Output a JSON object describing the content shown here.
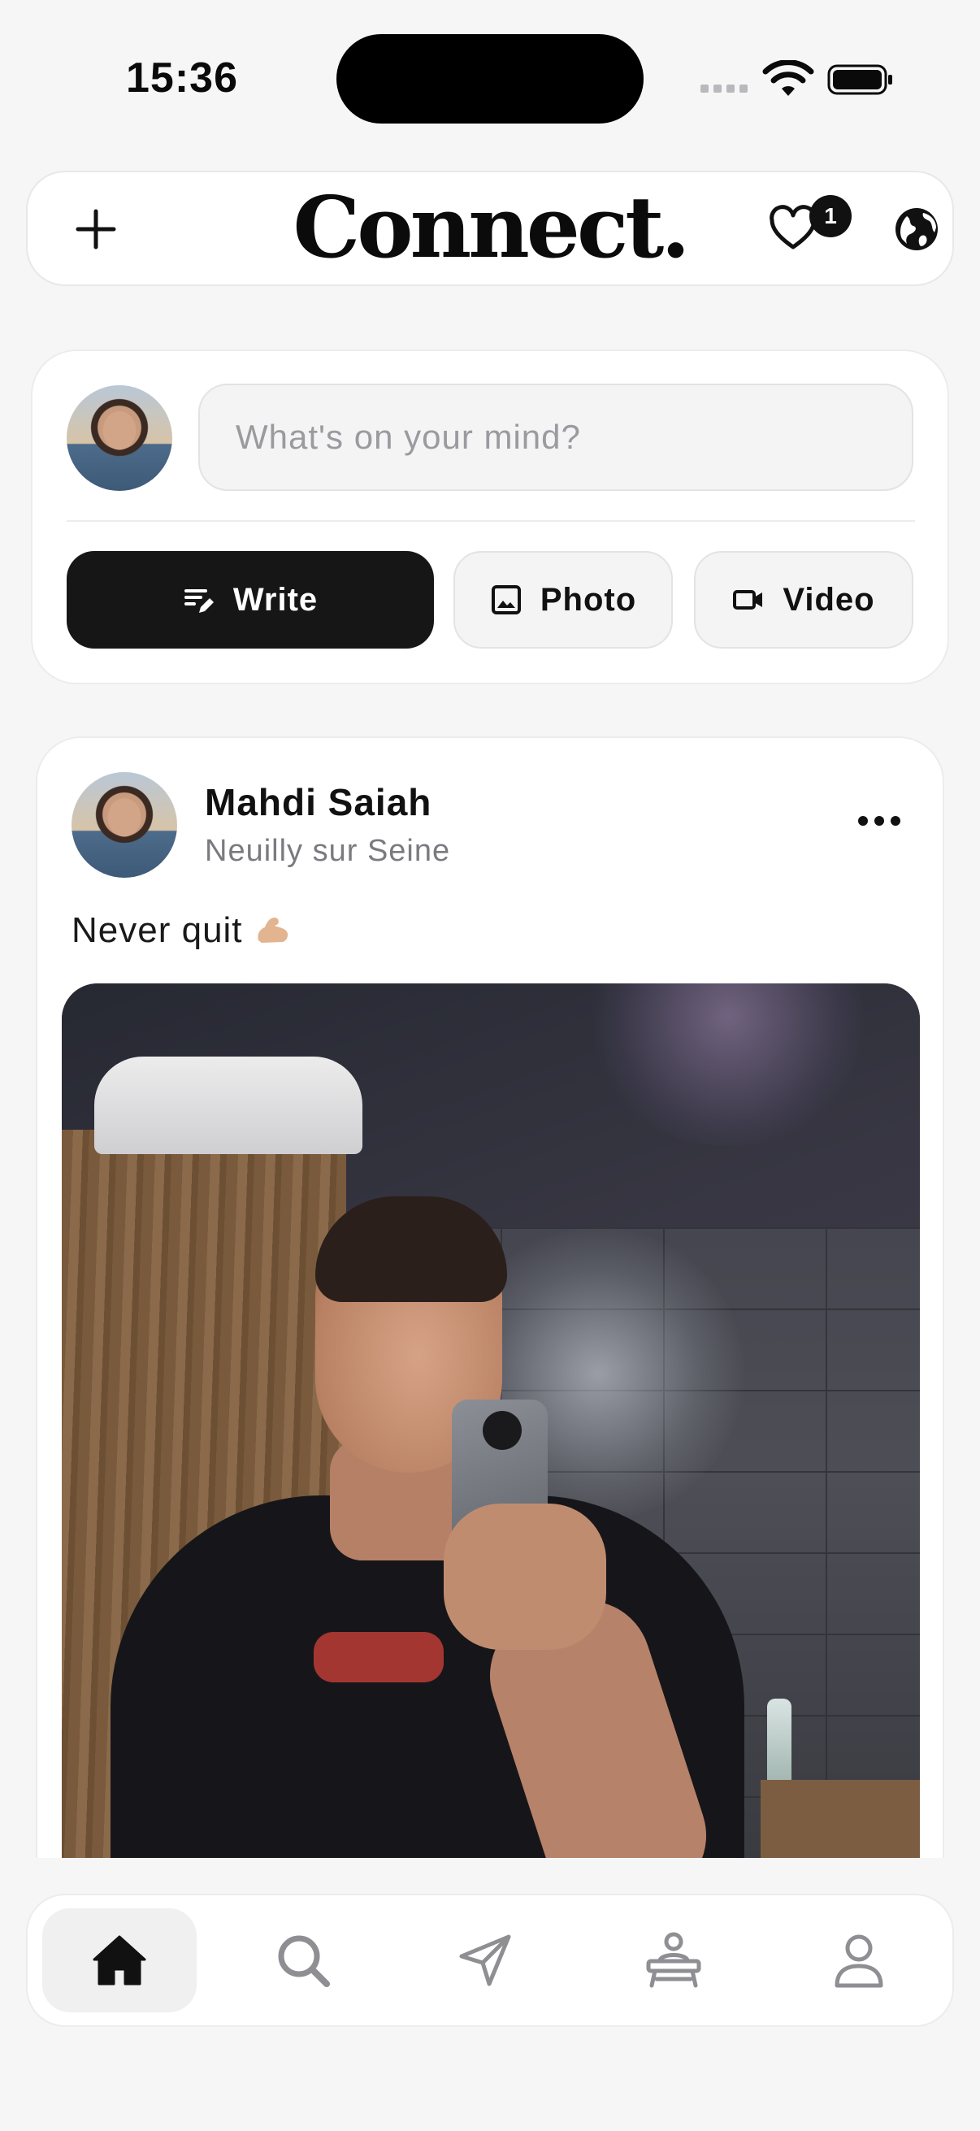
{
  "status_bar": {
    "time": "15:36"
  },
  "header": {
    "title": "Connect.",
    "notification_count": "1"
  },
  "composer": {
    "placeholder": "What's on your mind?",
    "write_label": "Write",
    "photo_label": "Photo",
    "video_label": "Video"
  },
  "post": {
    "author": "Mahdi Saiah",
    "location": "Neuilly sur Seine",
    "caption": "Never quit"
  },
  "icons": {
    "header": [
      "plus-icon",
      "heart-icon",
      "globe-icon"
    ],
    "tabbar": [
      "home-icon",
      "search-icon",
      "send-icon",
      "desk-icon",
      "profile-icon"
    ]
  },
  "colors": {
    "background": "#f6f6f7",
    "primary": "#161616",
    "muted": "#9a9a9f"
  }
}
